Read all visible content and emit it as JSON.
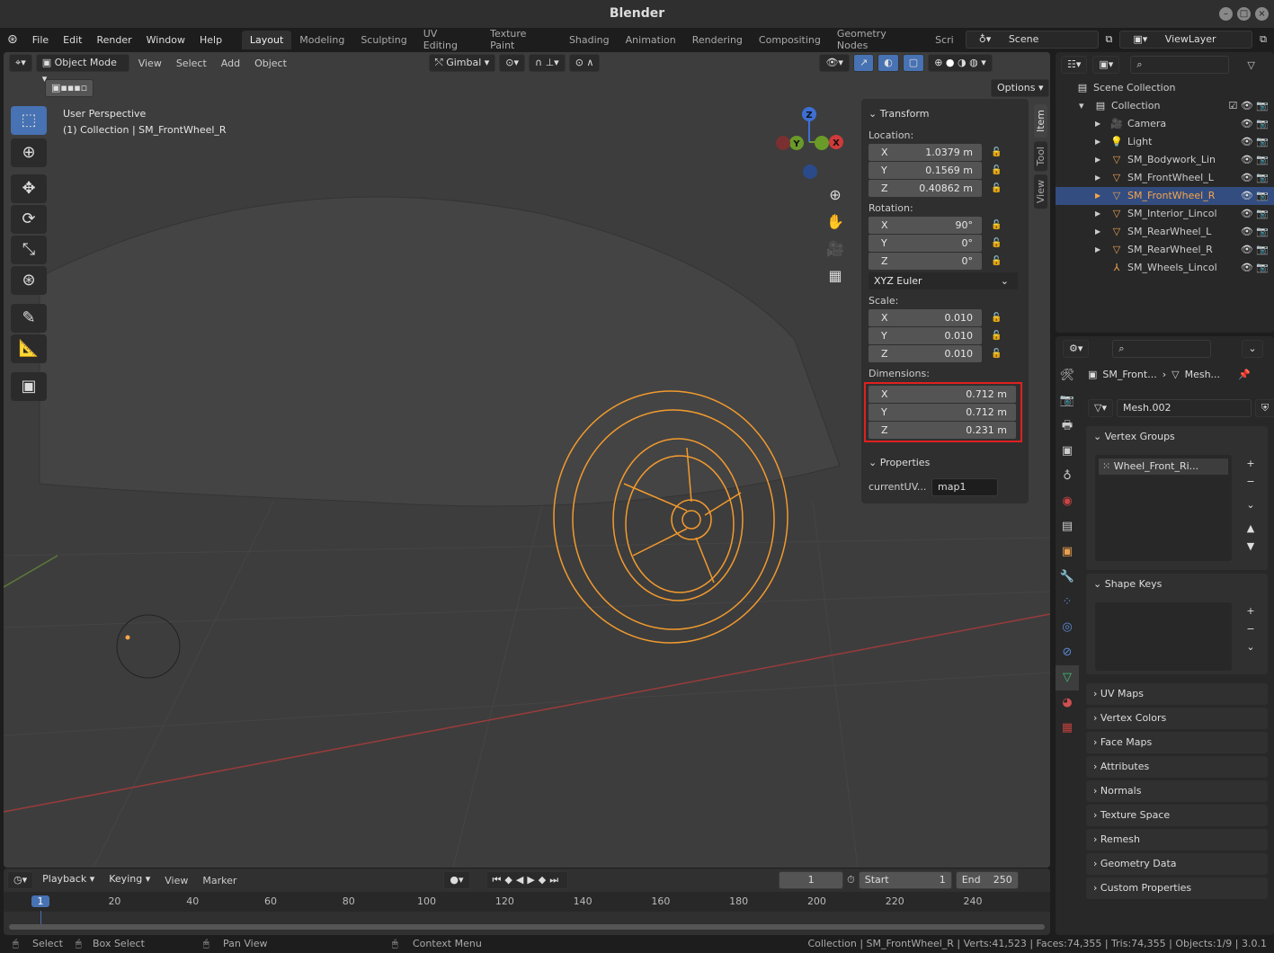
{
  "window": {
    "title": "Blender"
  },
  "menu": [
    "File",
    "Edit",
    "Render",
    "Window",
    "Help"
  ],
  "workspaces": [
    "Layout",
    "Modeling",
    "Sculpting",
    "UV Editing",
    "Texture Paint",
    "Shading",
    "Animation",
    "Rendering",
    "Compositing",
    "Geometry Nodes",
    "Scri"
  ],
  "scene": "Scene",
  "view_layer": "ViewLayer",
  "viewport": {
    "mode": "Object Mode",
    "menus": [
      "View",
      "Select",
      "Add",
      "Object"
    ],
    "orientation": "Gimbal",
    "options": "Options",
    "overlay_title": "User Perspective",
    "overlay_sub": "(1) Collection | SM_FrontWheel_R",
    "gizmo": {
      "x": "X",
      "y": "Y",
      "z": "Z"
    }
  },
  "npanel": {
    "tabs": [
      "Item",
      "Tool",
      "View"
    ],
    "transform": "Transform",
    "location_label": "Location:",
    "location": [
      [
        "X",
        "1.0379 m"
      ],
      [
        "Y",
        "0.1569 m"
      ],
      [
        "Z",
        "0.40862 m"
      ]
    ],
    "rotation_label": "Rotation:",
    "rotation": [
      [
        "X",
        "90°"
      ],
      [
        "Y",
        "0°"
      ],
      [
        "Z",
        "0°"
      ]
    ],
    "rotation_mode": "XYZ Euler",
    "scale_label": "Scale:",
    "scale": [
      [
        "X",
        "0.010"
      ],
      [
        "Y",
        "0.010"
      ],
      [
        "Z",
        "0.010"
      ]
    ],
    "dimensions_label": "Dimensions:",
    "dimensions": [
      [
        "X",
        "0.712 m"
      ],
      [
        "Y",
        "0.712 m"
      ],
      [
        "Z",
        "0.231 m"
      ]
    ],
    "properties": "Properties",
    "prop_name": "currentUV...",
    "prop_value": "map1"
  },
  "outliner": {
    "root": "Scene Collection",
    "collection": "Collection",
    "items": [
      "Camera",
      "Light",
      "SM_Bodywork_Lin",
      "SM_FrontWheel_L",
      "SM_FrontWheel_R",
      "SM_Interior_Lincol",
      "SM_RearWheel_L",
      "SM_RearWheel_R",
      "SM_Wheels_Lincol"
    ],
    "selected": "SM_FrontWheel_R"
  },
  "properties": {
    "breadcrumb_obj": "SM_Front...",
    "breadcrumb_mesh": "Mesh...",
    "mesh_name": "Mesh.002",
    "vertex_groups": "Vertex Groups",
    "vertex_group_item": "Wheel_Front_Ri...",
    "shape_keys": "Shape Keys",
    "panels": [
      "UV Maps",
      "Vertex Colors",
      "Face Maps",
      "Attributes",
      "Normals",
      "Texture Space",
      "Remesh",
      "Geometry Data",
      "Custom Properties"
    ]
  },
  "timeline": {
    "menus": [
      "Playback",
      "Keying",
      "View",
      "Marker"
    ],
    "current_frame": "1",
    "start_label": "Start",
    "start": "1",
    "end_label": "End",
    "end": "250",
    "ticks": [
      "1",
      "20",
      "40",
      "60",
      "80",
      "100",
      "120",
      "140",
      "160",
      "180",
      "200",
      "220",
      "240"
    ]
  },
  "status": {
    "select": "Select",
    "box_select": "Box Select",
    "pan_view": "Pan View",
    "context_menu": "Context Menu",
    "info": "Collection | SM_FrontWheel_R | Verts:41,523 | Faces:74,355 | Tris:74,355 | Objects:1/9 | 3.0.1"
  },
  "colors": {
    "accent": "#4772b3",
    "selection": "#f7a54a",
    "highlight_box": "#e02020"
  }
}
